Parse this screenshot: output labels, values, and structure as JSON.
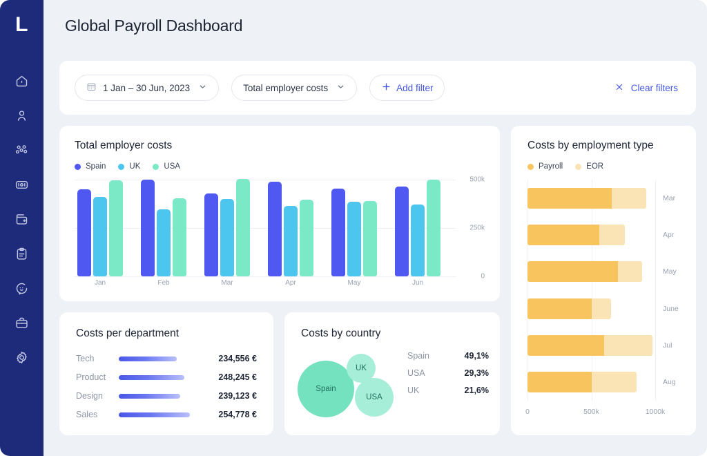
{
  "theme": {
    "sidebar_bg": "#1e2b7a",
    "page_bg": "#eef2f6",
    "accent": "#4356e0",
    "spain": "#5058f2",
    "uk": "#4cc5ef",
    "usa": "#7ce9c6",
    "payroll": "#f7c45e",
    "eor": "#fae4b6"
  },
  "sidebar": {
    "logo": "L",
    "items": [
      {
        "icon": "home-icon",
        "name": "home"
      },
      {
        "icon": "user-icon",
        "name": "people"
      },
      {
        "icon": "team-icon",
        "name": "team"
      },
      {
        "icon": "id-card-icon",
        "name": "id-card"
      },
      {
        "icon": "wallet-icon",
        "name": "payments"
      },
      {
        "icon": "clipboard-icon",
        "name": "documents"
      },
      {
        "icon": "chat-icon",
        "name": "support"
      },
      {
        "icon": "briefcase-icon",
        "name": "jobs"
      },
      {
        "icon": "gear-icon",
        "name": "settings"
      }
    ]
  },
  "header": {
    "title": "Global Payroll Dashboard"
  },
  "filters": {
    "date_range": "1 Jan – 30 Jun, 2023",
    "metric": "Total employer costs",
    "add_filter": "Add filter",
    "clear_filters": "Clear filters"
  },
  "cards": {
    "total_costs": {
      "title": "Total employer costs"
    },
    "employment_type": {
      "title": "Costs by employment type"
    },
    "department": {
      "title": "Costs per department"
    },
    "country": {
      "title": "Costs by country"
    }
  },
  "chart_data": [
    {
      "id": "total_employer_costs",
      "type": "bar",
      "title": "Total employer costs",
      "xlabel": "",
      "ylabel": "",
      "ylim": [
        0,
        500000
      ],
      "yticks": [
        "0",
        "250k",
        "500k"
      ],
      "grid": true,
      "legend_position": "top-left",
      "categories": [
        "Jan",
        "Feb",
        "Mar",
        "Apr",
        "May",
        "Jun"
      ],
      "series": [
        {
          "name": "Spain",
          "color": "#5058f2",
          "values": [
            450000,
            500000,
            430000,
            490000,
            455000,
            465000
          ]
        },
        {
          "name": "UK",
          "color": "#4cc5ef",
          "values": [
            410000,
            345000,
            400000,
            365000,
            385000,
            370000
          ]
        },
        {
          "name": "USA",
          "color": "#7ce9c6",
          "values": [
            495000,
            405000,
            505000,
            395000,
            390000,
            500000
          ]
        }
      ]
    },
    {
      "id": "costs_by_employment_type",
      "type": "bar",
      "orientation": "horizontal",
      "stacked": true,
      "title": "Costs by employment type",
      "xlim": [
        0,
        1000000
      ],
      "xticks": [
        "0",
        "500k",
        "1000k"
      ],
      "grid": true,
      "legend_position": "top-left",
      "categories": [
        "Mar",
        "Apr",
        "May",
        "June",
        "Jul",
        "Aug"
      ],
      "series": [
        {
          "name": "Payroll",
          "color": "#f7c45e",
          "values": [
            660000,
            560000,
            710000,
            500000,
            600000,
            500000
          ]
        },
        {
          "name": "EOR",
          "color": "#fae4b6",
          "values": [
            270000,
            200000,
            190000,
            150000,
            380000,
            350000
          ]
        }
      ]
    },
    {
      "id": "costs_per_department",
      "type": "bar",
      "orientation": "horizontal",
      "title": "Costs per department",
      "categories": [
        "Tech",
        "Product",
        "Design",
        "Sales"
      ],
      "values": [
        234556,
        248245,
        239123,
        254778
      ],
      "value_labels": [
        "234,556 €",
        "248,245 €",
        "239,123 €",
        "254,778 €"
      ],
      "bar_widths_pct": [
        72,
        82,
        77,
        89
      ]
    },
    {
      "id": "costs_by_country",
      "type": "bubble",
      "title": "Costs by country",
      "categories": [
        "Spain",
        "USA",
        "UK"
      ],
      "values": [
        49.1,
        29.3,
        21.6
      ],
      "value_labels": [
        "49,1%",
        "29,3%",
        "21,6%"
      ],
      "bubbles": [
        {
          "label": "Spain",
          "cx": 42,
          "cy": 59,
          "r": 41,
          "color": "#74e2bf"
        },
        {
          "label": "UK",
          "cx": 93,
          "cy": 29,
          "r": 21,
          "color": "#a6eed8"
        },
        {
          "label": "USA",
          "cx": 112,
          "cy": 71,
          "r": 28,
          "color": "#a6eed8"
        }
      ]
    }
  ]
}
